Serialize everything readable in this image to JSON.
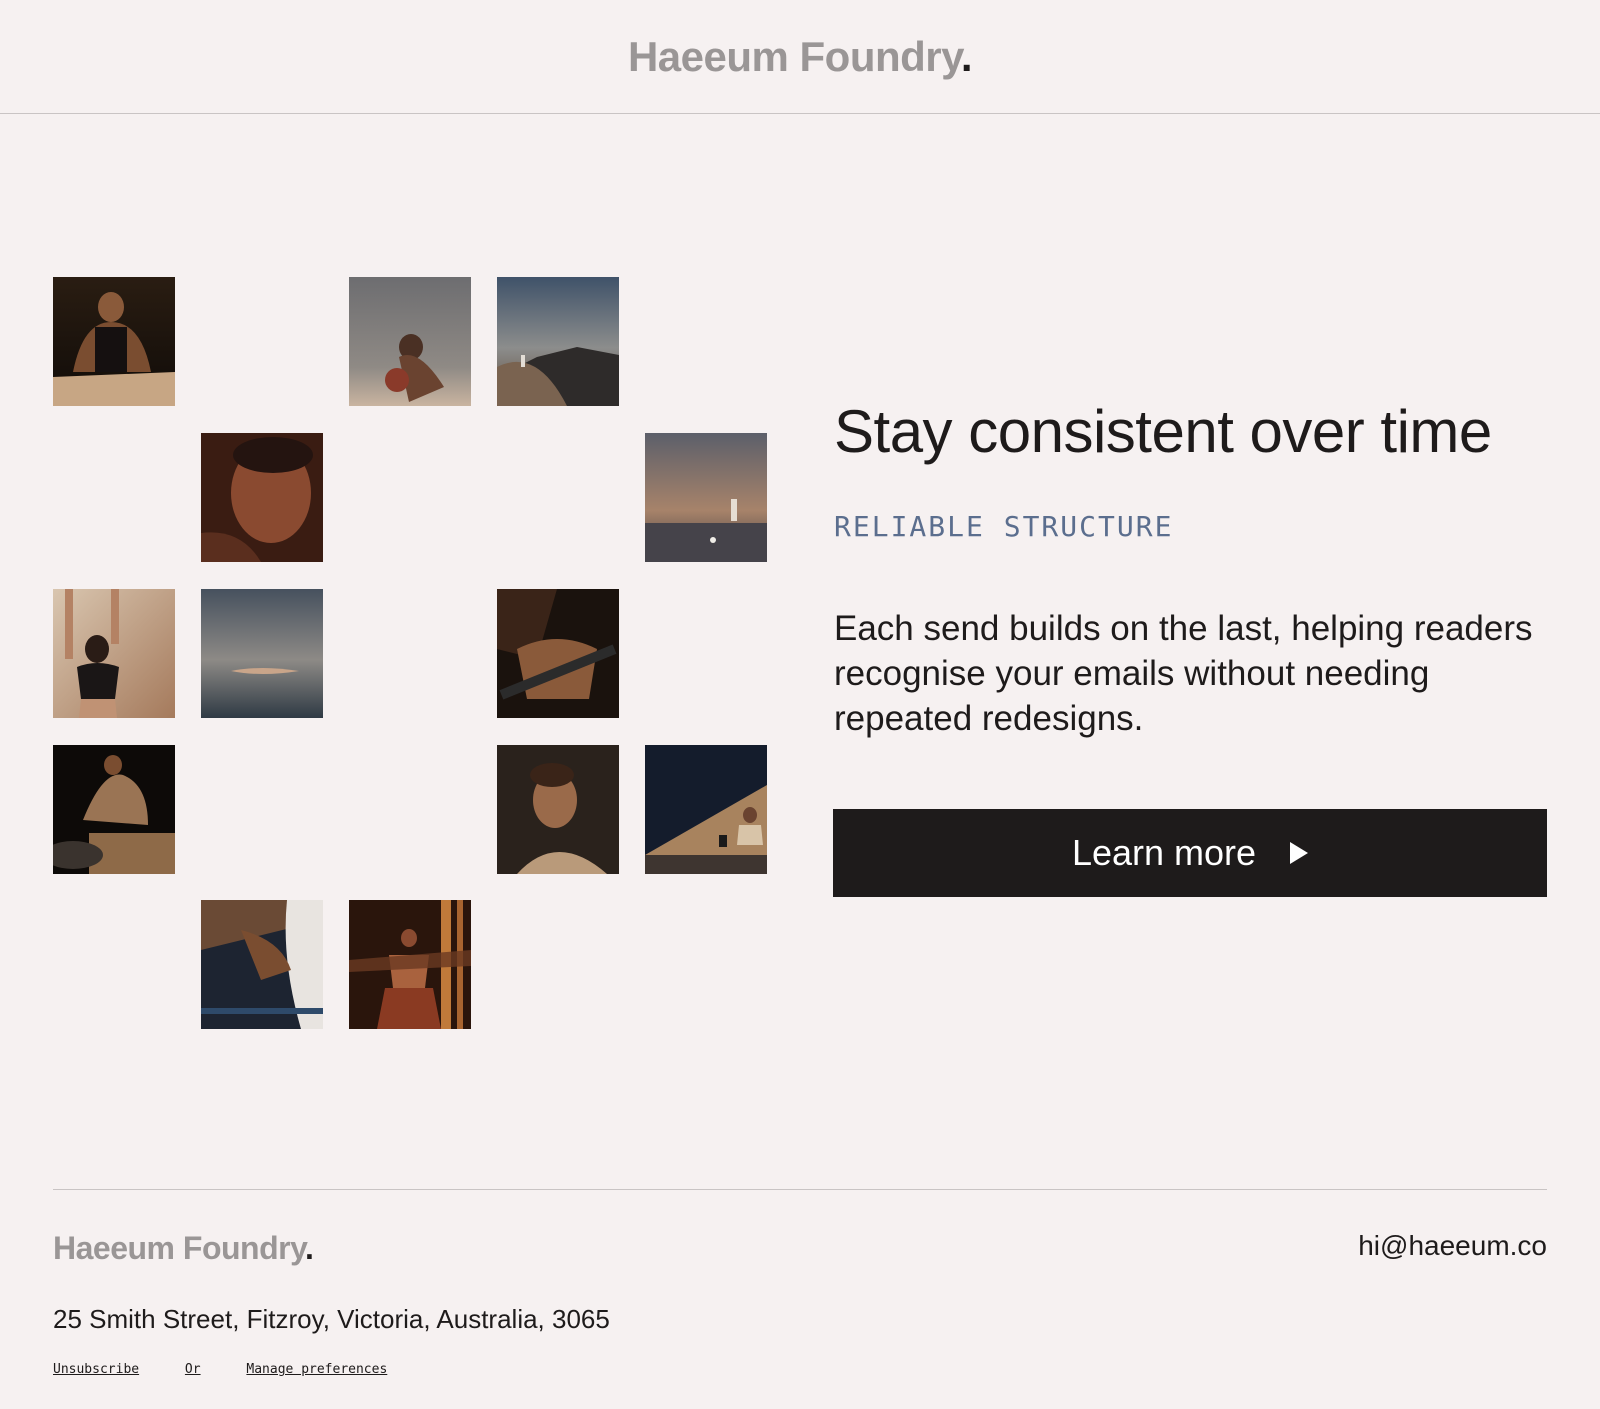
{
  "header": {
    "brand": "Haeeum Foundry",
    "brand_dot": "."
  },
  "hero": {
    "headline": "Stay consistent over time",
    "eyebrow": "RELIABLE STRUCTURE",
    "body": "Each send builds on the last, helping readers recognise your emails without needing repeated redesigns.",
    "cta_label": "Learn more"
  },
  "gallery": {
    "photos": [
      "athlete-crouching-photo",
      "boxer-photo",
      "desert-runner-photo",
      "face-closeup-photo",
      "beach-runner-photo",
      "woman-stretching-photo",
      "swimmer-photo",
      "hands-barbell-photo",
      "box-jump-photo",
      "man-portrait-photo",
      "kettlebell-squat-photo",
      "sprinter-photo",
      "group-class-photo"
    ]
  },
  "footer": {
    "brand": "Haeeum Foundry",
    "brand_dot": ".",
    "email": "hi@haeeum.co",
    "address": "25 Smith Street, Fitzroy, Victoria, Australia, 3065",
    "unsubscribe": "Unsubscribe",
    "or": "Or",
    "manage": "Manage preferences"
  },
  "colors": {
    "background": "#f6f1f1",
    "text": "#1e1b1b",
    "brand_grey": "#9a9696",
    "eyebrow": "#5b6e8e",
    "button": "#1e1b1b"
  }
}
